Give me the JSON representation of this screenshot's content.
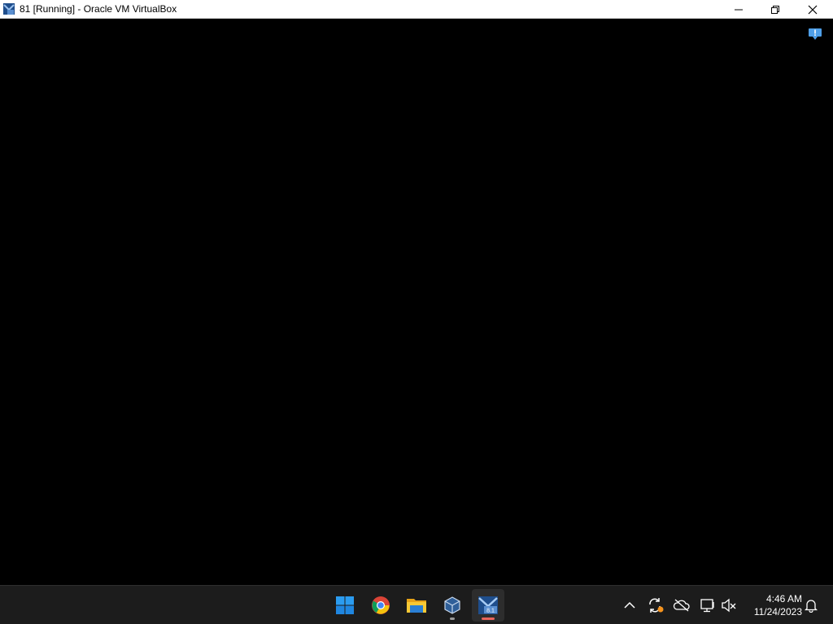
{
  "window": {
    "title": "81 [Running] - Oracle VM VirtualBox"
  },
  "titlebar_buttons": {
    "minimize": "minimize-icon",
    "restore": "restore-icon",
    "close": "close-icon"
  },
  "vm_screen": {
    "notice_icon": "info-notification-icon"
  },
  "taskbar": {
    "apps": [
      {
        "name": "Start",
        "icon": "windows-start-icon"
      },
      {
        "name": "Google Chrome",
        "icon": "chrome-icon"
      },
      {
        "name": "File Explorer",
        "icon": "folder-icon"
      },
      {
        "name": "Oracle VM VirtualBox",
        "icon": "virtualbox-icon"
      },
      {
        "name": "81 [Running] - Oracle VM VirtualBox",
        "icon": "virtualbox-vm-icon",
        "vm_badge": "8.1"
      }
    ],
    "tray": [
      {
        "icon": "chevron-up-icon"
      },
      {
        "icon": "sync-icon"
      },
      {
        "icon": "cloud-offline-icon"
      },
      {
        "icon": "network-icon"
      },
      {
        "icon": "speaker-muted-icon"
      }
    ],
    "clock": {
      "time": "4:46 AM",
      "date": "11/24/2023"
    },
    "notification_icon": "bell-icon"
  },
  "colors": {
    "taskbar_bg": "#1c1c1c",
    "active_indicator": "#e9655c",
    "accent_blue": "#0078d4"
  }
}
